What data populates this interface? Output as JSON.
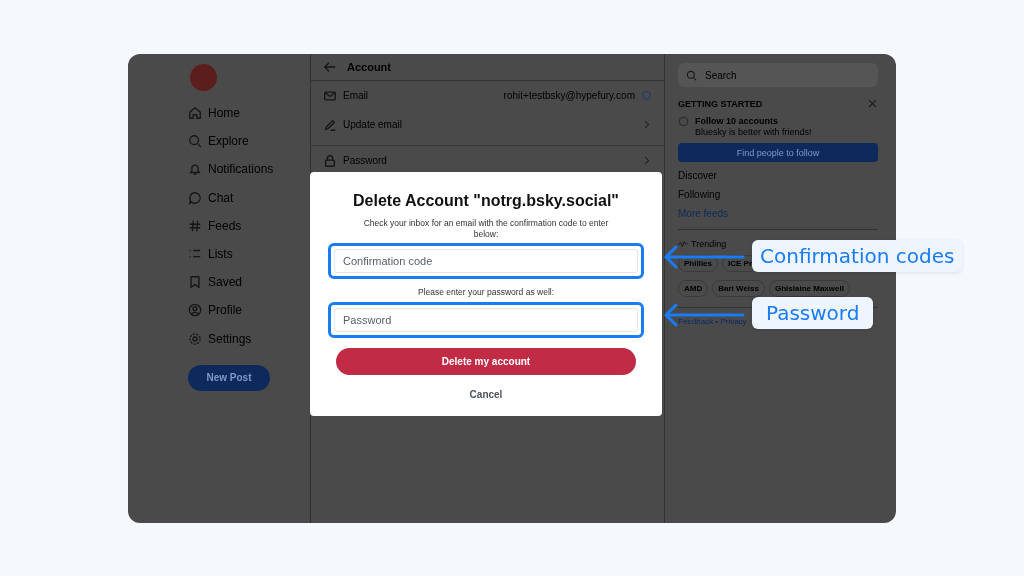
{
  "sidebar": {
    "items": [
      {
        "label": "Home",
        "kind": "home"
      },
      {
        "label": "Explore",
        "kind": "search"
      },
      {
        "label": "Notifications",
        "kind": "bell"
      },
      {
        "label": "Chat",
        "kind": "chat"
      },
      {
        "label": "Feeds",
        "kind": "hash"
      },
      {
        "label": "Lists",
        "kind": "list"
      },
      {
        "label": "Saved",
        "kind": "bookmark"
      },
      {
        "label": "Profile",
        "kind": "profile"
      },
      {
        "label": "Settings",
        "kind": "gear"
      }
    ],
    "new_post": "New Post"
  },
  "main": {
    "title": "Account",
    "rows": [
      {
        "label": "Email",
        "kind": "email",
        "value": "rohit+testbsky@hypefury.com"
      },
      {
        "label": "Update email",
        "kind": "edit"
      },
      {
        "label": "Password",
        "kind": "lock"
      }
    ]
  },
  "right": {
    "search": {
      "placeholder": "Search"
    },
    "getting_started": "GETTING STARTED",
    "task_title": "Follow 10 accounts",
    "task_subtitle": "Bluesky is better with friends!",
    "find_button": "Find people to follow",
    "feeds": [
      {
        "label": "Discover",
        "kind": "plain"
      },
      {
        "label": "Following",
        "kind": "plain"
      },
      {
        "label": "More feeds",
        "kind": "link"
      }
    ],
    "trending_title": "Trending",
    "trending": [
      "Phillies",
      "ICE Pr",
      "AMD",
      "Bari Weiss",
      "Ghislaine Maxwell"
    ],
    "footer": "Feedback • Privacy"
  },
  "dialog": {
    "title": "Delete Account \"notrg.bsky.social\"",
    "instructions": "Check your inbox for an email with the confirmation code to enter below:",
    "fields": [
      {
        "placeholder": "Confirmation code",
        "highlighted": true
      },
      {
        "label": "Please enter your password as well:",
        "placeholder": "Password",
        "highlighted": true
      }
    ],
    "delete_button": "Delete my account",
    "cancel_button": "Cancel"
  },
  "callouts": [
    "Confirmation codes",
    "Password"
  ]
}
